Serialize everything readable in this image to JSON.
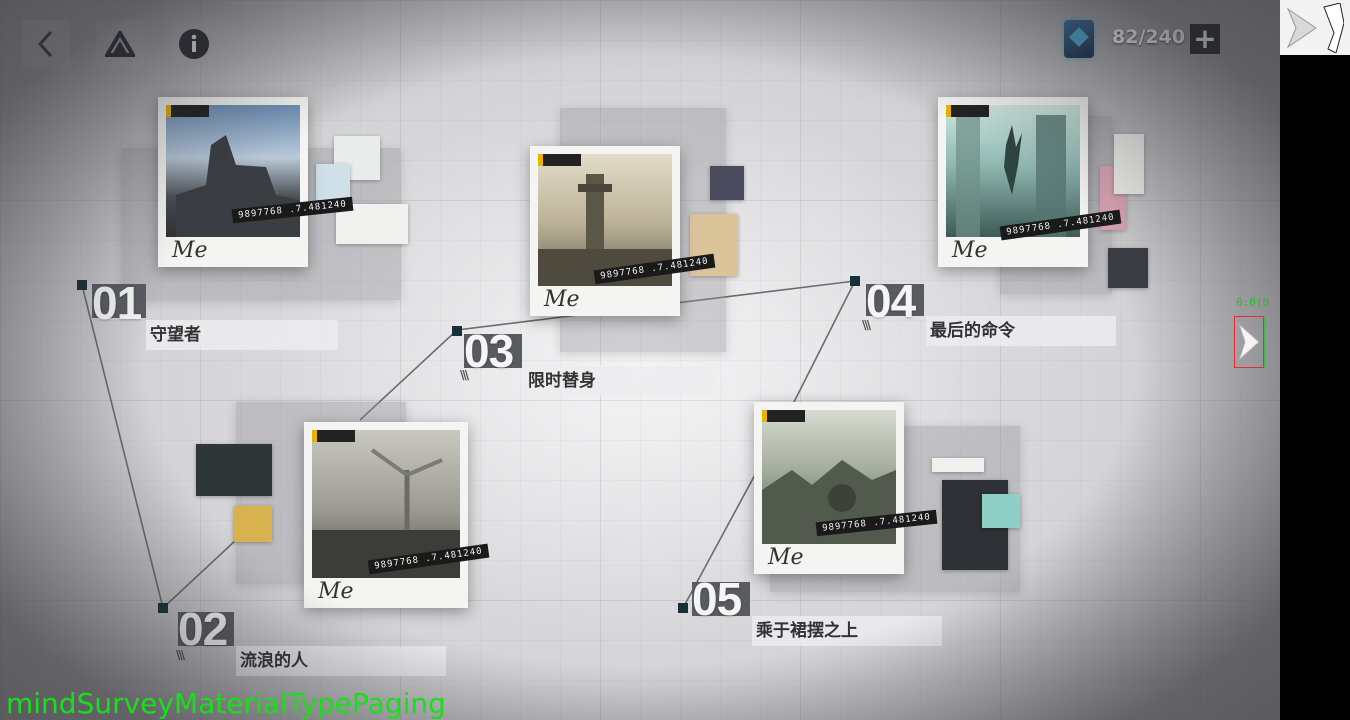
{
  "resource": {
    "count": "82/240",
    "icon": "data-card-icon",
    "add_label": "+"
  },
  "top_buttons": {
    "back_icon": "back-chevron-icon",
    "drive_icon": "drive-icon",
    "info_icon": "info-icon"
  },
  "stamp_code": "9897768 .7.481240",
  "signature": "Me",
  "nodes": [
    {
      "number": "01",
      "title": "守望者"
    },
    {
      "number": "02",
      "title": "流浪的人"
    },
    {
      "number": "03",
      "title": "限时替身"
    },
    {
      "number": "04",
      "title": "最后的命令"
    },
    {
      "number": "05",
      "title": "乘于裙摆之上"
    }
  ],
  "side_arrow": {
    "icon": "next-page-arrow-icon",
    "debug_text": "0:0|",
    "debug_tail": "0"
  },
  "debug_overlay": "mindSurveyMaterialTypePaging",
  "colors": {
    "node": "#17303a",
    "number_bg": "#585b60",
    "accent_tag": "#e8b400",
    "debug_green": "#18e018"
  }
}
